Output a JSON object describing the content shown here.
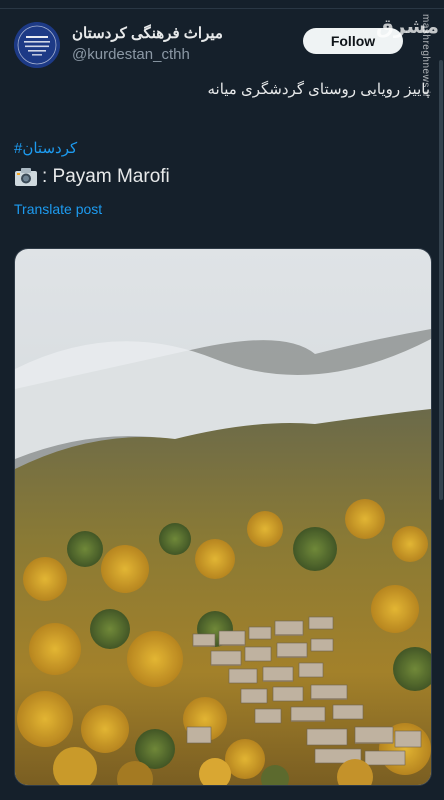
{
  "post": {
    "author": {
      "display_name": "میراث فرهنگی کردستان",
      "handle": "@kurdestan_cthh",
      "avatar_icon": "organization-logo-icon"
    },
    "follow_label": "Follow",
    "text": "پاییز رویایی روستای گردشگری میانه",
    "hashtag": "#کردستان",
    "credit": ": Payam Marofi",
    "credit_icon": "camera-icon",
    "translate_label": "Translate post",
    "image_alt_icon": "landscape-photo"
  },
  "watermark": {
    "logo": "مشرق",
    "site": "mashreghnews.ir"
  },
  "colors": {
    "background": "#15202b",
    "link": "#1d9bf0",
    "follow_bg": "#eff3f4",
    "text": "#e7e9ea",
    "muted": "#8b98a5"
  }
}
